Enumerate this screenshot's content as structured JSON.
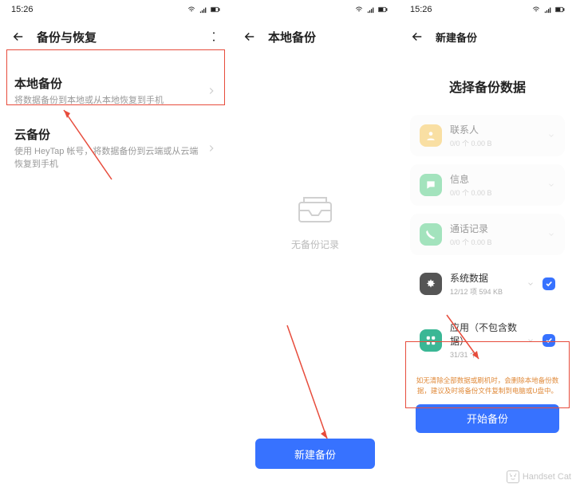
{
  "status": {
    "time": "15:26"
  },
  "screen1": {
    "header": "备份与恢复",
    "items": [
      {
        "title": "本地备份",
        "sub": "将数据备份到本地或从本地恢复到手机"
      },
      {
        "title": "云备份",
        "sub": "使用 HeyTap 帐号，将数据备份到云端或从云端恢复到手机"
      }
    ]
  },
  "screen2": {
    "header": "本地备份",
    "empty": "无备份记录",
    "button": "新建备份"
  },
  "screen3": {
    "header": "新建备份",
    "title": "选择备份数据",
    "cards": [
      {
        "title": "联系人",
        "sub": "0/0 个  0.00 B"
      },
      {
        "title": "信息",
        "sub": "0/0 个  0.00 B"
      },
      {
        "title": "通话记录",
        "sub": "0/0 个  0.00 B"
      },
      {
        "title": "系统数据",
        "sub": "12/12 项  594 KB"
      },
      {
        "title": "应用（不包含数据）",
        "sub": "31/31 个"
      }
    ],
    "warn": "如无清除全部数据或刷机时，会删除本地备份数据，建议及时将备份文件复制到电脑或U盘中。",
    "button": "开始备份"
  },
  "watermark": "Handset Cat"
}
